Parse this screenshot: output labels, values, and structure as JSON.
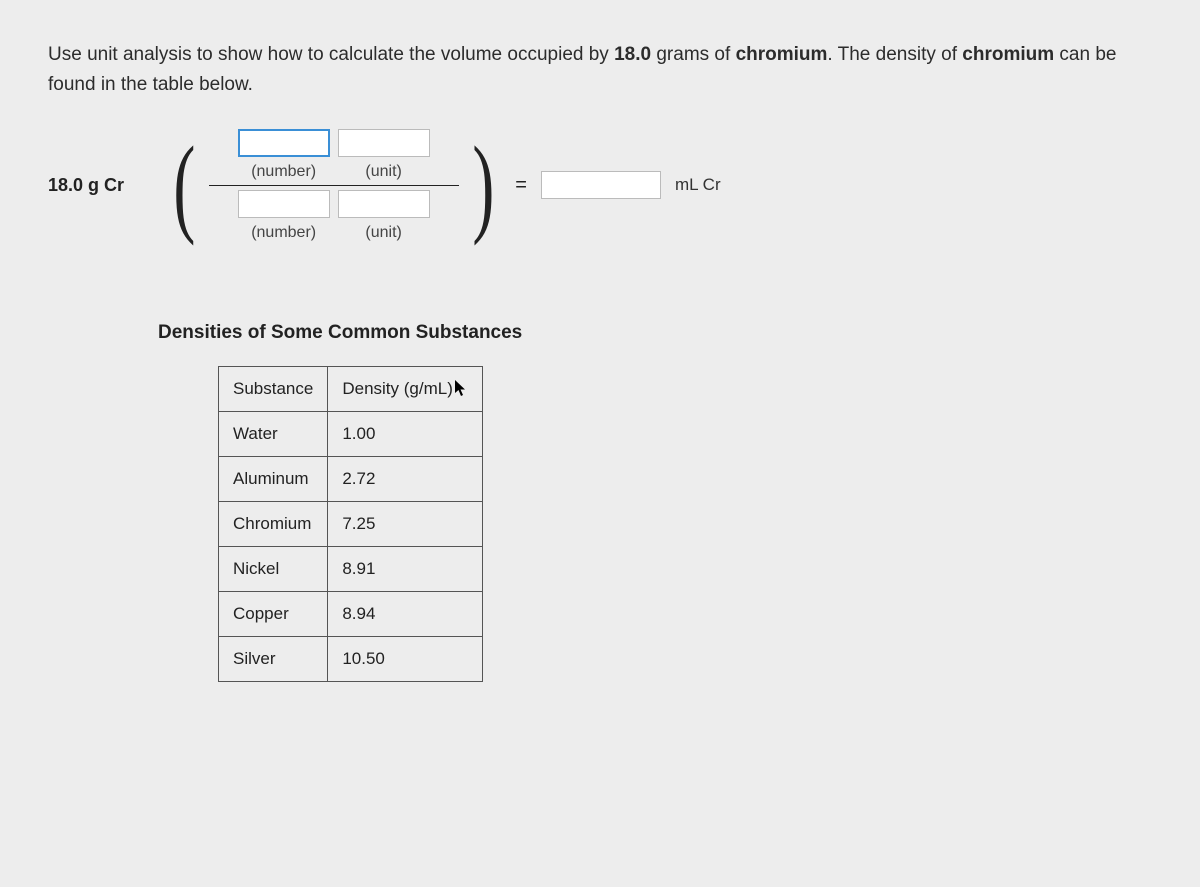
{
  "prompt": {
    "pre": "Use unit analysis to show how to calculate the volume occupied by ",
    "mass": "18.0",
    "mass_unit": " grams",
    "mid": " of ",
    "element": "chromium",
    "post1": ". The density of ",
    "element2": "chromium",
    "post2": " can be found in the table below."
  },
  "equation": {
    "given": "18.0 g Cr",
    "num_number_label": "(number)",
    "num_unit_label": "(unit)",
    "den_number_label": "(number)",
    "den_unit_label": "(unit)",
    "equals": "=",
    "answer_unit": "mL Cr"
  },
  "table": {
    "title": "Densities of Some Common Substances",
    "col1": "Substance",
    "col2": "Density (g/mL)",
    "rows": [
      {
        "name": "Water",
        "d": "1.00"
      },
      {
        "name": "Aluminum",
        "d": "2.72"
      },
      {
        "name": "Chromium",
        "d": "7.25"
      },
      {
        "name": "Nickel",
        "d": "8.91"
      },
      {
        "name": "Copper",
        "d": "8.94"
      },
      {
        "name": "Silver",
        "d": "10.50"
      }
    ]
  }
}
